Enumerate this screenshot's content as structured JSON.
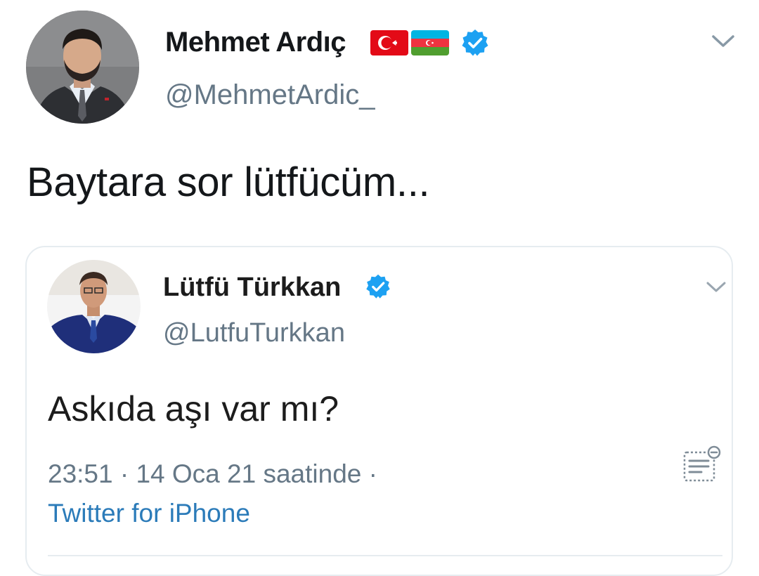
{
  "tweet": {
    "author": {
      "name": "Mehmet Ardıç",
      "handle": "@MehmetArdic_",
      "flags": [
        "turkey-flag-icon",
        "azerbaijan-flag-icon"
      ],
      "verified": true
    },
    "text": "Baytara sor lütfücüm...",
    "menu_icon": "chevron-down-icon"
  },
  "quoted_tweet": {
    "author": {
      "name": "Lütfü Türkkan",
      "handle": "@LutfuTurkkan",
      "verified": true
    },
    "text": "Askıda aşı var mı?",
    "meta": "23:51 · 14 Oca 21 saatinde ·",
    "source": "Twitter for iPhone",
    "menu_icon": "chevron-down-icon",
    "analytics_icon": "tweet-analytics-icon"
  },
  "colors": {
    "verified": "#1da1f2",
    "secondary_text": "#657786",
    "link": "#2b7bb9",
    "border": "#e6ecf0"
  }
}
